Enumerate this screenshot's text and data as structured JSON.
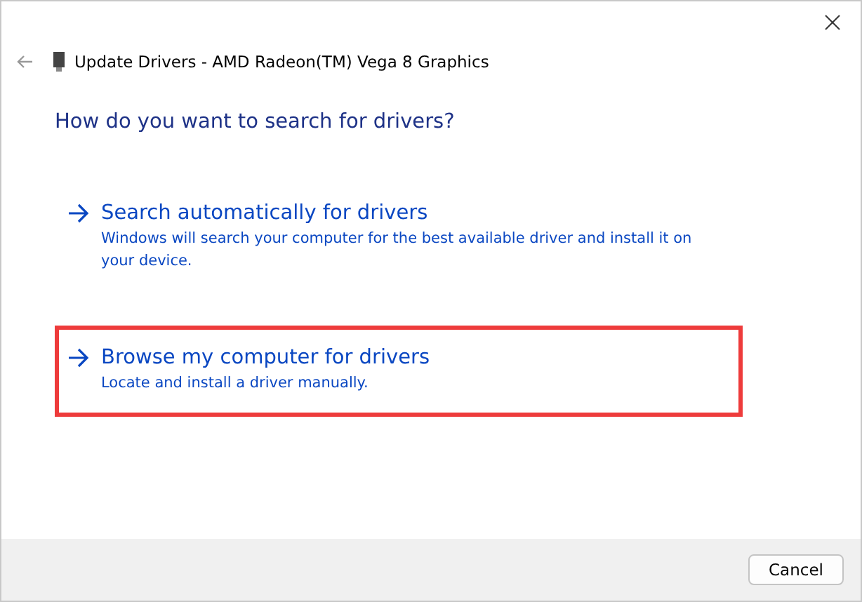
{
  "window": {
    "title": "Update Drivers - AMD Radeon(TM) Vega 8 Graphics"
  },
  "heading": "How do you want to search for drivers?",
  "options": [
    {
      "title": "Search automatically for drivers",
      "description": "Windows will search your computer for the best available driver and install it on your device.",
      "highlighted": false
    },
    {
      "title": "Browse my computer for drivers",
      "description": "Locate and install a driver manually.",
      "highlighted": true
    }
  ],
  "buttons": [
    "Cancel"
  ]
}
